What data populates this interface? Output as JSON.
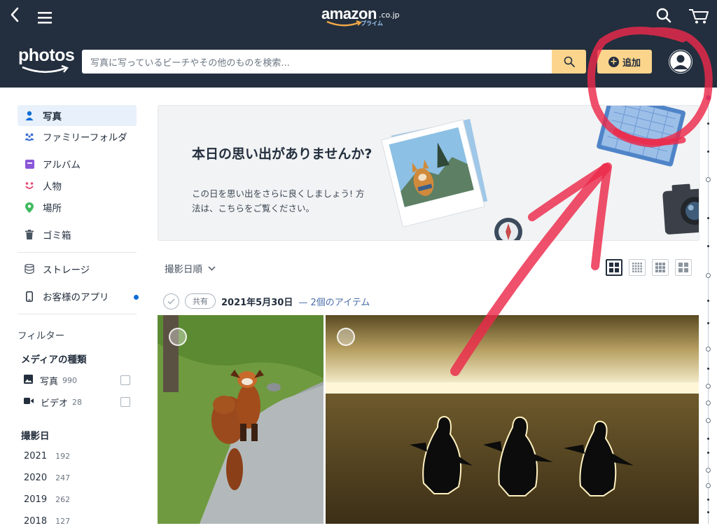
{
  "header": {
    "brand": "amazon",
    "brand_tld": ".co.jp",
    "brand_sub": "プライム",
    "app_name": "photos",
    "search_placeholder": "写真に写っているビーチやその他のものを検索...",
    "add_label": "追加"
  },
  "sidebar": {
    "items": [
      {
        "label": "写真",
        "icon": "person-icon"
      },
      {
        "label": "ファミリーフォルダ",
        "icon": "family-icon"
      },
      {
        "label": "アルバム",
        "icon": "album-icon"
      },
      {
        "label": "人物",
        "icon": "face-icon"
      },
      {
        "label": "場所",
        "icon": "location-pin-icon"
      },
      {
        "label": "ゴミ箱",
        "icon": "trash-icon"
      },
      {
        "label": "ストレージ",
        "icon": "storage-icon"
      },
      {
        "label": "お客様のアプリ",
        "icon": "phone-icon"
      }
    ],
    "filter_heading": "フィルター",
    "media_heading": "メディアの種類",
    "media": [
      {
        "label": "写真",
        "count": "990"
      },
      {
        "label": "ビデオ",
        "count": "28"
      }
    ],
    "date_heading": "撮影日",
    "years": [
      {
        "year": "2021",
        "count": "192"
      },
      {
        "year": "2020",
        "count": "247"
      },
      {
        "year": "2019",
        "count": "262"
      },
      {
        "year": "2018",
        "count": "127"
      }
    ]
  },
  "banner": {
    "title": "本日の思い出がありませんか?",
    "description": "この日を思い出をさらに良くしましょう! 方法は、こちらをご覧ください。"
  },
  "toolbar": {
    "sort_label": "撮影日順"
  },
  "group": {
    "shared_label": "共有",
    "date": "2021年5月30日",
    "count": "— 2個のアイテム"
  },
  "colors": {
    "header_bg": "#232f3e",
    "accent_button": "#fcd58d",
    "annotation_red": "#ec2a4a",
    "active_item_bg": "#e8f1fb"
  }
}
